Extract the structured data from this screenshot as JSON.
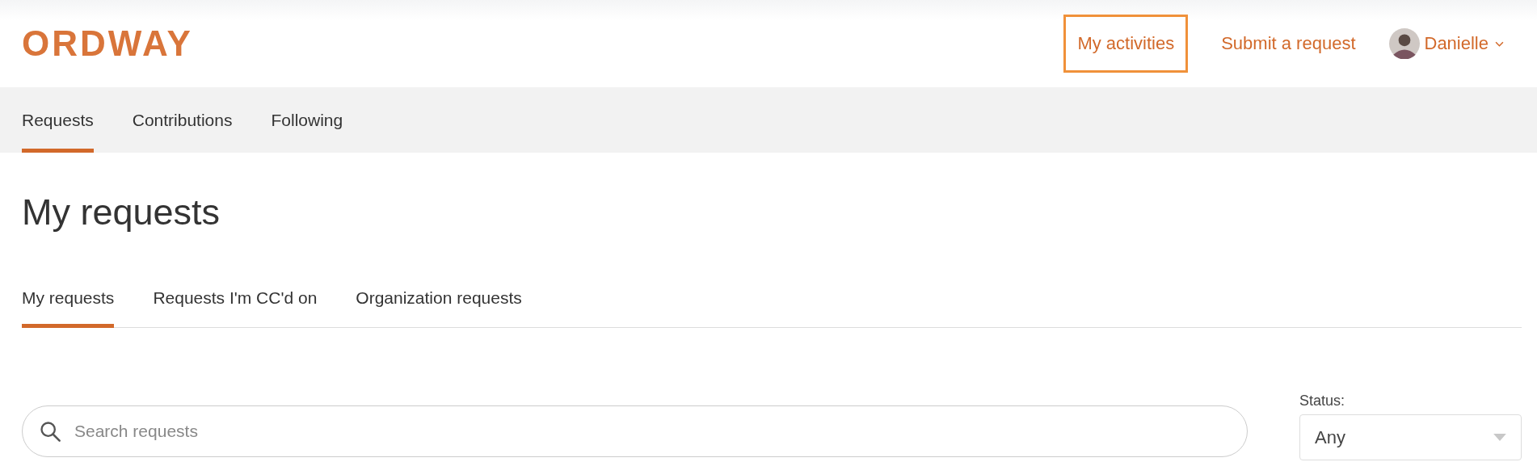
{
  "header": {
    "logo": "ORDWAY",
    "links": [
      {
        "label": "My activities",
        "focused": true
      },
      {
        "label": "Submit a request",
        "focused": false
      }
    ],
    "user": {
      "name": "Danielle"
    }
  },
  "nav_tabs": [
    {
      "label": "Requests",
      "selected": true
    },
    {
      "label": "Contributions",
      "selected": false
    },
    {
      "label": "Following",
      "selected": false
    }
  ],
  "page_title": "My requests",
  "sub_tabs": [
    {
      "label": "My requests",
      "selected": true
    },
    {
      "label": "Requests I'm CC'd on",
      "selected": false
    },
    {
      "label": "Organization requests",
      "selected": false
    }
  ],
  "search": {
    "placeholder": "Search requests"
  },
  "status_filter": {
    "label": "Status:",
    "value": "Any"
  }
}
